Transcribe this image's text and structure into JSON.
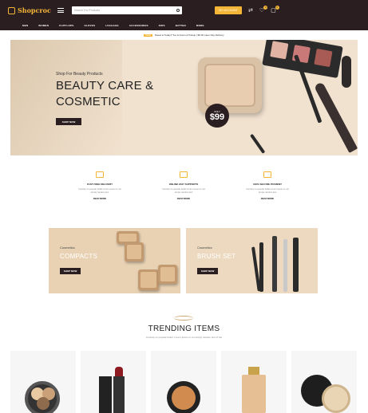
{
  "header": {
    "logo_text": "Shopcroc",
    "search_placeholder": "Search For Products",
    "account_label": "MY ACCOUNT",
    "compare_count": "0",
    "wishlist_count": "0",
    "cart_count": "0"
  },
  "nav": [
    "MEN",
    "WOMEN",
    "FLIPFLOPS",
    "GLOVES",
    "LUGGAGE",
    "ACCESSORIES",
    "KIDS",
    "BATTEN",
    "MORE"
  ],
  "promo_bar": {
    "badge": "SALE",
    "text": "Sweet & Today!! Toe & Gown & Pickup | $6.00 Later Day Delivery"
  },
  "hero": {
    "kicker": "Shop For Beauty Products",
    "title_line1": "BEAUTY CARE &",
    "title_line2": "COSMETIC",
    "button": "SHOP NOW",
    "price_label": "ONLY",
    "price": "$99"
  },
  "features": [
    {
      "title": "FAST FREE DELIVERY",
      "desc": "Contrary to popular belief Lorem Ipsum is not simply random text",
      "link": "READ MORE"
    },
    {
      "title": "ONLINE 24X7 SUPPORTS",
      "desc": "Contrary to popular belief Lorem Ipsum is not simply random text",
      "link": "READ MORE"
    },
    {
      "title": "100% SECURE PAYMENT",
      "desc": "Contrary to popular belief Lorem Ipsum is not simply random text",
      "link": "READ MORE"
    }
  ],
  "banners": [
    {
      "kicker": "Cosmetics",
      "title": "COMPACTS",
      "button": "SHOP NOW"
    },
    {
      "kicker": "Cosmetics",
      "title": "BRUSH SET",
      "button": "SHOP NOW"
    }
  ],
  "trending": {
    "title": "TRENDING ITEMS",
    "subtitle": "Contrary to popular belief, Lorem Ipsum is not simply random text of the"
  },
  "colors": {
    "brand_dark": "#2b1e20",
    "accent": "#f4b637",
    "hero_bg": "#f1e2cf"
  },
  "icons": [
    "hamburger-icon",
    "search-icon",
    "compare-icon",
    "heart-icon",
    "cart-icon",
    "truck-icon",
    "chat-icon",
    "card-icon"
  ]
}
